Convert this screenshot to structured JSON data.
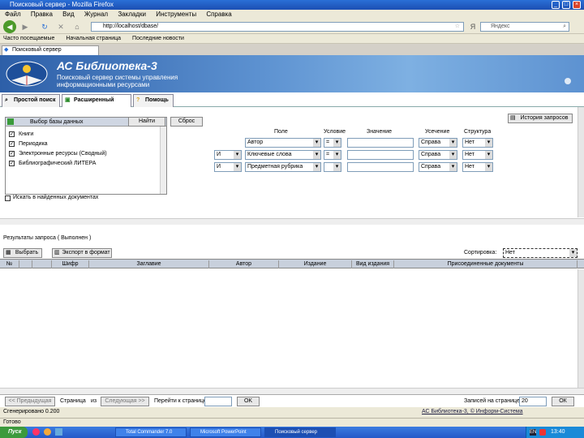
{
  "window": {
    "title": "Поисковый сервер - Mozilla Firefox"
  },
  "menu": [
    "Файл",
    "Правка",
    "Вид",
    "Журнал",
    "Закладки",
    "Инструменты",
    "Справка"
  ],
  "nav": {
    "url": "http://localhost/dbase/",
    "search_placeholder": "Яндекс"
  },
  "bookmarks": [
    "Часто посещаемые",
    "Начальная страница",
    "Последние новости"
  ],
  "browser_tab": "Поисковый сервер",
  "banner": {
    "title": "АС Библиотека-3",
    "subtitle": "Поисковый сервер системы управления информационными ресурсами"
  },
  "mode_tabs": [
    "Простой поиск",
    "Расширенный поиск",
    "Помощь"
  ],
  "query": {
    "db_header": "Выбор базы данных",
    "databases": [
      "Книги",
      "Периодика",
      "Электронные ресурсы (Сводный)",
      "Библиографический ЛИТЕРА"
    ],
    "find_button": "Найти",
    "reset_button": "Сброс",
    "history_button": "История запросов",
    "columns": [
      "Поле",
      "Условие",
      "Значение",
      "Усечение",
      "Структура"
    ],
    "rows": [
      {
        "logic": "",
        "field": "Автор",
        "cond": "=",
        "value": "",
        "trunc": "Справа",
        "struct": "Нет"
      },
      {
        "logic": "И",
        "field": "Ключевые слова",
        "cond": "=",
        "value": "",
        "trunc": "Справа",
        "struct": "Нет"
      },
      {
        "logic": "И",
        "field": "Предметная рубрика",
        "cond": "",
        "value": "",
        "trunc": "Справа",
        "struct": "Нет"
      }
    ],
    "search_in_found": "Искать в найденных документах"
  },
  "results": {
    "title": "Результаты запроса ( Выполнен )",
    "btn_select": "Выбрать",
    "btn_export": "Экспорт в формат",
    "sort_label": "Сортировка:",
    "sort_value": "Нет",
    "columns": [
      "№",
      "",
      "",
      "Шифр",
      "Заглавие",
      "Автор",
      "Издание",
      "Вид издания",
      "Присоединенные документы"
    ]
  },
  "pager": {
    "prev": "<< Предыдущая",
    "page_label": "Страница",
    "page_sep": "из",
    "next": "Следующая >>",
    "goto_label": "Перейти к странице",
    "goto_btn": "OK",
    "per_page_label": "Записей на странице:",
    "per_page_value": "20",
    "ok": "ОК"
  },
  "status": {
    "left": "Сгенерировано 0.200",
    "right": "АС Библиотека-3, © Информ-Система",
    "ready": "Готово"
  },
  "taskbar": {
    "start": "Пуск",
    "tasks": [
      "Total Commander 7.0",
      "Microsoft PowerPoint",
      "Поисковый сервер"
    ],
    "clock": "13:40"
  }
}
